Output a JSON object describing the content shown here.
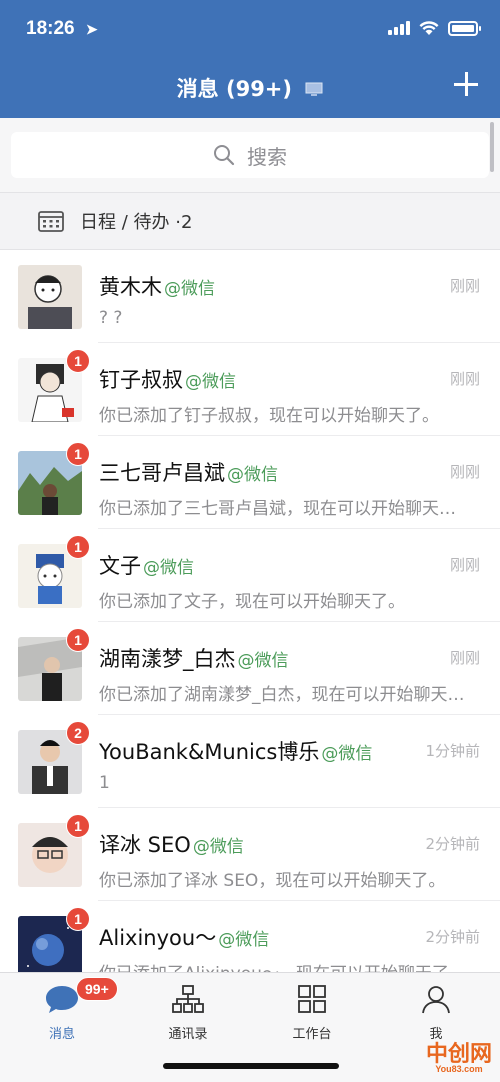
{
  "status_bar": {
    "time": "18:26"
  },
  "header": {
    "title": "消息 (99+)"
  },
  "search": {
    "placeholder": "搜索"
  },
  "schedule": {
    "label": "日程 / 待办 ·2"
  },
  "messages": [
    {
      "name": "黄木木",
      "tag": "@微信",
      "time": "刚刚",
      "preview": "? ?",
      "badge": ""
    },
    {
      "name": "钉子叔叔",
      "tag": "@微信",
      "time": "刚刚",
      "preview": "你已添加了钉子叔叔，现在可以开始聊天了。",
      "badge": "1"
    },
    {
      "name": "三七哥卢昌斌",
      "tag": "@微信",
      "time": "刚刚",
      "preview": "你已添加了三七哥卢昌斌，现在可以开始聊天了。",
      "badge": "1"
    },
    {
      "name": "文子",
      "tag": "@微信",
      "time": "刚刚",
      "preview": "你已添加了文子，现在可以开始聊天了。",
      "badge": "1"
    },
    {
      "name": "湖南漾梦_白杰",
      "tag": "@微信",
      "time": "刚刚",
      "preview": "你已添加了湖南漾梦_白杰，现在可以开始聊天了。",
      "badge": "1"
    },
    {
      "name": "YouBank&Munics博乐",
      "tag": "@微信",
      "time": "1分钟前",
      "preview": "1",
      "badge": "2"
    },
    {
      "name": "译冰 SEO",
      "tag": "@微信",
      "time": "2分钟前",
      "preview": "你已添加了译冰 SEO，现在可以开始聊天了。",
      "badge": "1"
    },
    {
      "name": "Alixinyou～",
      "tag": "@微信",
      "time": "2分钟前",
      "preview": "你已添加了Alixinyou～，现在可以开始聊天了。",
      "badge": "1"
    }
  ],
  "tabbar": {
    "messages": {
      "label": "消息",
      "badge": "99+"
    },
    "contacts": {
      "label": "通讯录"
    },
    "workbench": {
      "label": "工作台"
    },
    "me": {
      "label": "我"
    }
  },
  "watermark": {
    "main": "中创网",
    "sub": "You83.com"
  },
  "colors": {
    "header": "#3f72b7",
    "badge": "#e6493a",
    "tag": "#4c9c5a"
  }
}
